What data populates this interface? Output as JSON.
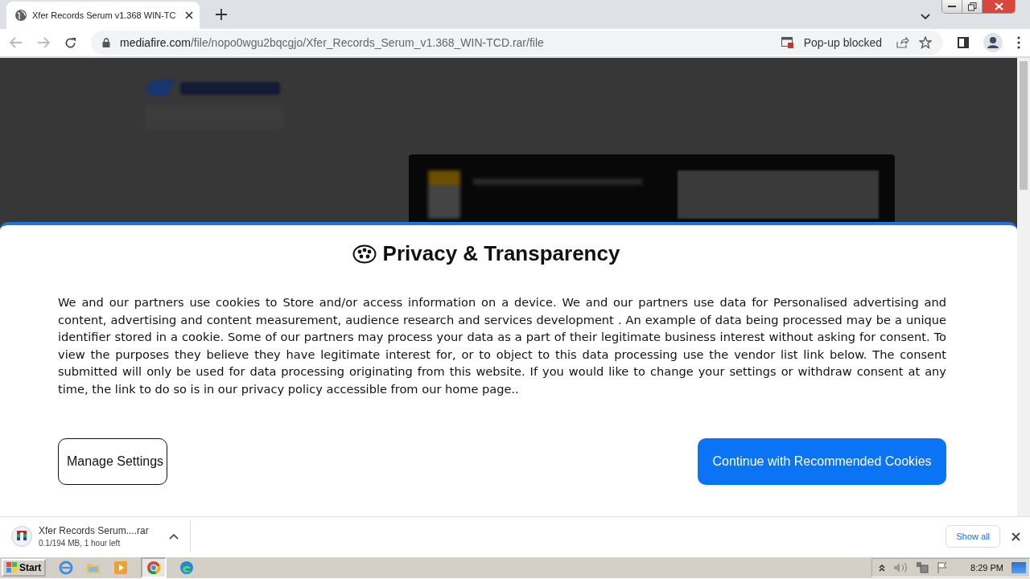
{
  "browser": {
    "tab": {
      "title": "Xfer Records Serum v1.368 WIN-TC",
      "selected": true
    },
    "address": {
      "domain": "mediafire.com",
      "path": "/file/nopo0wgu2bqcgjo/Xfer_Records_Serum_v1.368_WIN-TCD.rar/file"
    },
    "popup_notice": "Pop-up blocked"
  },
  "dialog": {
    "title": "Privacy & Transparency",
    "body": "We and our partners use cookies to Store and/or access information on a device. We and our partners use data for Personalised advertising and content, advertising and content measurement, audience research and services development . An example of data being processed may be a unique identifier stored in a cookie. Some of our partners may process your data as a part of their legitimate business interest without asking for consent. To view the purposes they believe they have legitimate interest for, or to object to this data processing use the vendor list link below. The consent submitted will only be used for data processing originating from this website. If you would like to change your settings or withdraw consent at any time, the link to do so is in our privacy policy accessible from our home page..",
    "buttons": [
      {
        "label": "Manage Settings",
        "kind": "outline"
      },
      {
        "label": "Continue with Recommended Cookies",
        "kind": "primary"
      }
    ]
  },
  "download_bar": {
    "file": "Xfer Records Serum....rar",
    "status": "0.1/194 MB, 1 hour left",
    "show_all": "Show all"
  },
  "taskbar": {
    "start": "Start",
    "clock": "8:29 PM"
  }
}
